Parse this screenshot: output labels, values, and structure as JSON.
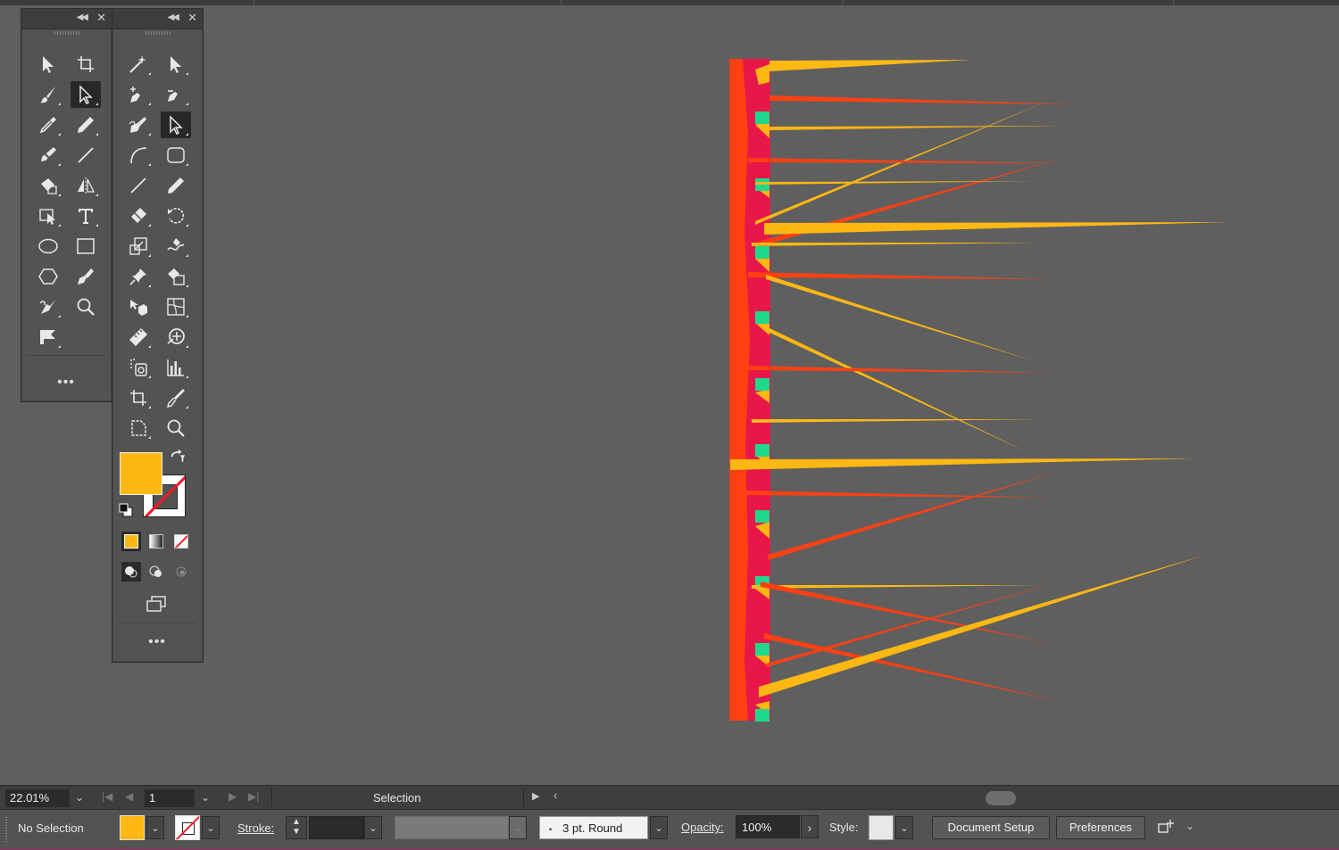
{
  "colors": {
    "fill": "#FDB813",
    "accent_red": "#FF4013",
    "accent_crimson": "#E8174A",
    "accent_green": "#1ED88C"
  },
  "toolbar_left": {
    "more_label": "•••",
    "tools": [
      {
        "icon": "selection-tool-icon"
      },
      {
        "icon": "artboard-tool-icon"
      },
      {
        "icon": "paintbrush-tool-icon"
      },
      {
        "icon": "direct-selection-tool-icon"
      },
      {
        "icon": "eyedropper-tool-icon"
      },
      {
        "icon": "pencil-tool-icon"
      },
      {
        "icon": "blob-brush-tool-icon"
      },
      {
        "icon": "line-segment-tool-icon"
      },
      {
        "icon": "live-paint-bucket-icon"
      },
      {
        "icon": "reflect-tool-icon"
      },
      {
        "icon": "perspective-selection-icon"
      },
      {
        "icon": "type-tool-icon"
      },
      {
        "icon": "ellipse-tool-icon"
      },
      {
        "icon": "rectangle-tool-icon"
      },
      {
        "icon": "polygon-tool-icon"
      },
      {
        "icon": "pen-tool-icon"
      },
      {
        "icon": "curvature-pen-icon"
      },
      {
        "icon": "zoom-tool-icon"
      },
      {
        "icon": "flag-tool-icon"
      }
    ]
  },
  "toolbar_right": {
    "more_label": "•••",
    "tools": [
      {
        "icon": "magic-wand-icon"
      },
      {
        "icon": "direct-selection-icon"
      },
      {
        "icon": "add-anchor-point-icon"
      },
      {
        "icon": "anchor-point-icon"
      },
      {
        "icon": "pen-tool-icon"
      },
      {
        "icon": "group-selection-icon"
      },
      {
        "icon": "curvature-tool-icon"
      },
      {
        "icon": "rounded-rectangle-icon"
      },
      {
        "icon": "line-segment-icon"
      },
      {
        "icon": "pencil-icon"
      },
      {
        "icon": "eraser-icon"
      },
      {
        "icon": "rotate-icon"
      },
      {
        "icon": "scale-icon"
      },
      {
        "icon": "warp-icon"
      },
      {
        "icon": "pin-icon"
      },
      {
        "icon": "live-paint-selection-icon"
      },
      {
        "icon": "shape-builder-icon"
      },
      {
        "icon": "mesh-icon"
      },
      {
        "icon": "measure-icon"
      },
      {
        "icon": "symbol-sprayer-icon"
      },
      {
        "icon": "symbol-icon"
      },
      {
        "icon": "column-graph-icon"
      },
      {
        "icon": "artboard-icon"
      },
      {
        "icon": "slice-icon"
      },
      {
        "icon": "page-icon"
      },
      {
        "icon": "zoom-icon"
      }
    ]
  },
  "status": {
    "zoom": "22.01%",
    "artboard": "1",
    "tool_name": "Selection"
  },
  "control": {
    "selection_label": "No Selection",
    "stroke_label": "Stroke:",
    "brush_label": "3 pt. Round",
    "opacity_label": "Opacity:",
    "opacity_value": "100%",
    "style_label": "Style:",
    "document_setup_label": "Document Setup",
    "preferences_label": "Preferences"
  }
}
